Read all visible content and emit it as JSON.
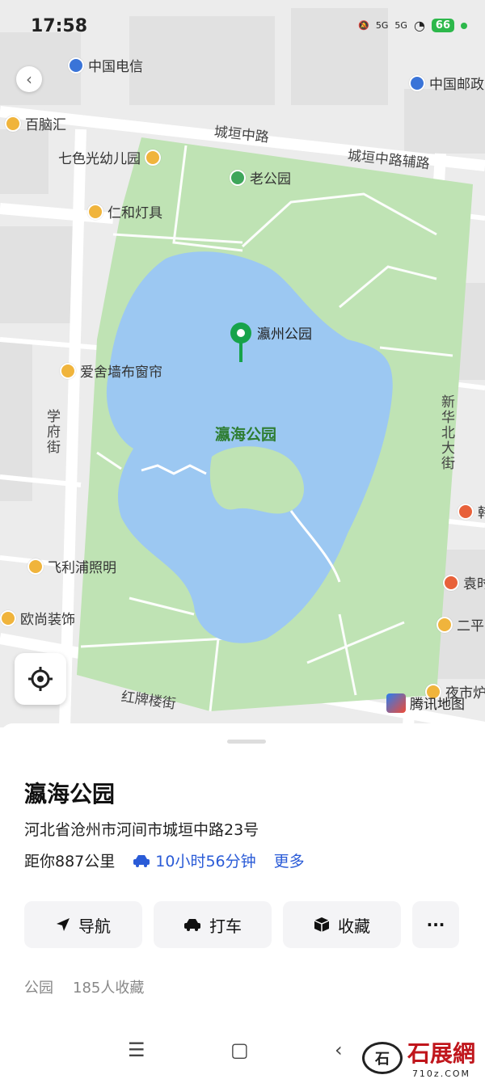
{
  "status_bar": {
    "time": "17:58",
    "signal1": "5G",
    "signal2": "5G",
    "battery": "66"
  },
  "map": {
    "pois": [
      {
        "name": "中国电信",
        "color": "blue"
      },
      {
        "name": "中国邮政",
        "color": "blue"
      },
      {
        "name": "百脑汇",
        "color": "yellow"
      },
      {
        "name": "七色光幼儿园",
        "color": "yellow"
      },
      {
        "name": "老公园",
        "color": "green"
      },
      {
        "name": "仁和灯具",
        "color": "yellow"
      },
      {
        "name": "爱舍墙布窗帘",
        "color": "yellow"
      },
      {
        "name": "飞利浦照明",
        "color": "yellow"
      },
      {
        "name": "欧尚装饰",
        "color": "yellow"
      },
      {
        "name": "韩",
        "color": "red"
      },
      {
        "name": "袁时",
        "color": "red"
      },
      {
        "name": "二平",
        "color": "yellow"
      },
      {
        "name": "夜市炉",
        "color": "yellow"
      }
    ],
    "roads": {
      "north": "城垣中路",
      "north_aux": "城垣中路辅路",
      "west": "学府街",
      "east": "新华北大街",
      "south": "红牌楼街"
    },
    "pin_label": "瀛州公园",
    "park_label": "瀛海公园",
    "attribution": "腾讯地图"
  },
  "place": {
    "title": "瀛海公园",
    "address": "河北省沧州市河间市城垣中路23号",
    "distance": "距你887公里",
    "drive_time": "10小时56分钟",
    "more": "更多"
  },
  "actions": {
    "navigate": "导航",
    "taxi": "打车",
    "favorite": "收藏",
    "more": "···"
  },
  "stats": {
    "category": "公园",
    "favorites": "185人收藏"
  },
  "watermark": {
    "brand": "石展網",
    "domain": "710z.COM",
    "seal": "石"
  },
  "colors": {
    "water": "#9cc8f2",
    "park": "#bfe3b4",
    "road": "#ffffff",
    "ground": "#ececec",
    "accent": "#2a5bd7",
    "pin": "#17a34a"
  }
}
